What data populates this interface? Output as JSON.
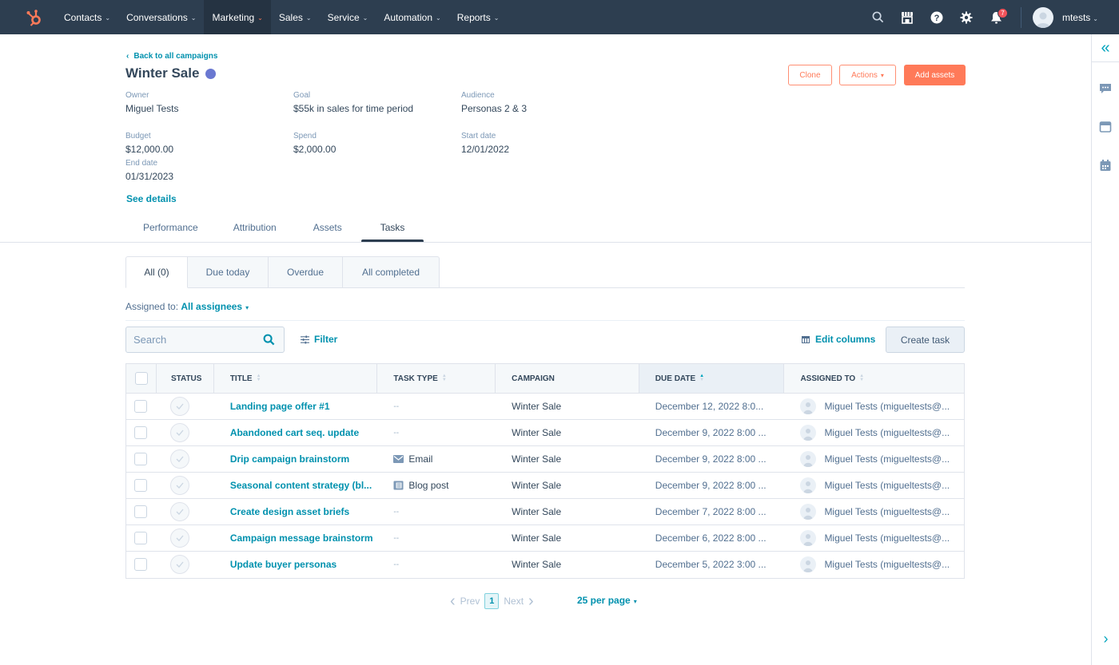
{
  "topnav": {
    "items": [
      {
        "label": "Contacts",
        "active": false
      },
      {
        "label": "Conversations",
        "active": false
      },
      {
        "label": "Marketing",
        "active": true
      },
      {
        "label": "Sales",
        "active": false
      },
      {
        "label": "Service",
        "active": false
      },
      {
        "label": "Automation",
        "active": false
      },
      {
        "label": "Reports",
        "active": false
      }
    ],
    "notification_count": "7",
    "user_name": "mtests",
    "icons": [
      "search-icon",
      "marketplace-icon",
      "help-icon",
      "settings-icon",
      "notifications-icon"
    ]
  },
  "header": {
    "back_link": "Back to all campaigns",
    "title": "Winter Sale",
    "title_dot_color": "#6a78d1",
    "fields": {
      "owner": {
        "label": "Owner",
        "value": "Miguel Tests"
      },
      "goal": {
        "label": "Goal",
        "value": "$55k in sales for time period"
      },
      "audience": {
        "label": "Audience",
        "value": "Personas 2 & 3"
      },
      "budget": {
        "label": "Budget",
        "value": "$12,000.00"
      },
      "spend": {
        "label": "Spend",
        "value": "$2,000.00"
      },
      "start_date": {
        "label": "Start date",
        "value": "12/01/2022"
      },
      "end_date": {
        "label": "End date",
        "value": "01/31/2023"
      }
    },
    "see_details": "See details",
    "buttons": {
      "clone": "Clone",
      "actions": "Actions",
      "add_assets": "Add assets"
    }
  },
  "main_tabs": [
    {
      "label": "Performance",
      "active": false
    },
    {
      "label": "Attribution",
      "active": false
    },
    {
      "label": "Assets",
      "active": false
    },
    {
      "label": "Tasks",
      "active": true
    }
  ],
  "sub_tabs": [
    {
      "label": "All (0)",
      "active": true
    },
    {
      "label": "Due today",
      "active": false
    },
    {
      "label": "Overdue",
      "active": false
    },
    {
      "label": "All completed",
      "active": false
    }
  ],
  "assigned": {
    "label": "Assigned to:",
    "value": "All assignees"
  },
  "toolbar": {
    "search_placeholder": "Search",
    "filter": "Filter",
    "edit_columns": "Edit columns",
    "create_task": "Create task"
  },
  "table": {
    "columns": [
      "STATUS",
      "TITLE",
      "TASK TYPE",
      "CAMPAIGN",
      "DUE DATE",
      "ASSIGNED TO"
    ],
    "sorted_column": "DUE DATE",
    "rows": [
      {
        "title": "Landing page offer #1",
        "task_type": "--",
        "task_type_icon": "",
        "campaign": "Winter Sale",
        "due_date": "December 12, 2022 8:0...",
        "assigned_to": "Miguel Tests (migueltests@..."
      },
      {
        "title": "Abandoned cart seq. update",
        "task_type": "--",
        "task_type_icon": "",
        "campaign": "Winter Sale",
        "due_date": "December 9, 2022 8:00 ...",
        "assigned_to": "Miguel Tests (migueltests@..."
      },
      {
        "title": "Drip campaign brainstorm",
        "task_type": "Email",
        "task_type_icon": "email-icon",
        "campaign": "Winter Sale",
        "due_date": "December 9, 2022 8:00 ...",
        "assigned_to": "Miguel Tests (migueltests@..."
      },
      {
        "title": "Seasonal content strategy (bl...",
        "task_type": "Blog post",
        "task_type_icon": "blog-icon",
        "campaign": "Winter Sale",
        "due_date": "December 9, 2022 8:00 ...",
        "assigned_to": "Miguel Tests (migueltests@..."
      },
      {
        "title": "Create design asset briefs",
        "task_type": "--",
        "task_type_icon": "",
        "campaign": "Winter Sale",
        "due_date": "December 7, 2022 8:00 ...",
        "assigned_to": "Miguel Tests (migueltests@..."
      },
      {
        "title": "Campaign message brainstorm",
        "task_type": "--",
        "task_type_icon": "",
        "campaign": "Winter Sale",
        "due_date": "December 6, 2022 8:00 ...",
        "assigned_to": "Miguel Tests (migueltests@..."
      },
      {
        "title": "Update buyer personas",
        "task_type": "--",
        "task_type_icon": "",
        "campaign": "Winter Sale",
        "due_date": "December 5, 2022 3:00 ...",
        "assigned_to": "Miguel Tests (migueltests@..."
      }
    ]
  },
  "pagination": {
    "prev": "Prev",
    "current_page": "1",
    "next": "Next",
    "per_page": "25 per page"
  },
  "colors": {
    "nav_bg": "#2d3e50",
    "brand_orange": "#ff7a59",
    "link_teal": "#0091ae"
  }
}
